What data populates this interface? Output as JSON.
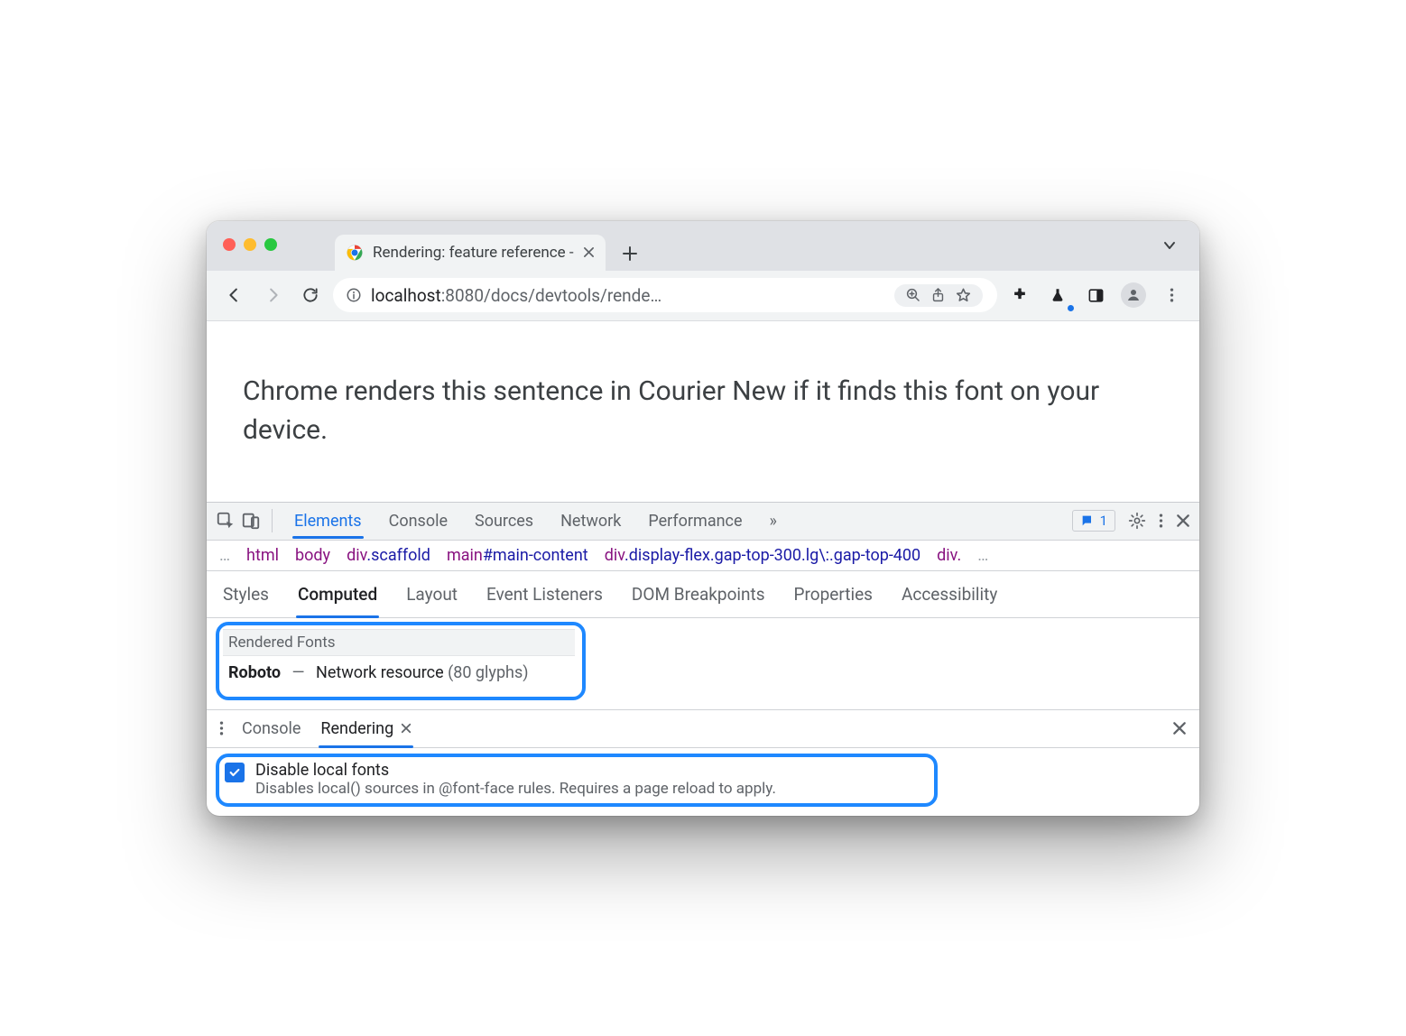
{
  "chrome": {
    "tab_title": "Rendering: feature reference -",
    "url_host": "localhost",
    "url_port": ":8080",
    "url_path": "/docs/devtools/rende…"
  },
  "page": {
    "text": "Chrome renders this sentence in Courier New if it finds this font on your device."
  },
  "devtools": {
    "tabs": {
      "elements": "Elements",
      "console": "Console",
      "sources": "Sources",
      "network": "Network",
      "performance": "Performance",
      "more": "»"
    },
    "issues_count": "1",
    "breadcrumb": {
      "ell_left": "…",
      "html": "html",
      "body": "body",
      "scaffold_tag": "div",
      "scaffold_cls": ".scaffold",
      "main_tag": "main",
      "main_id": "#main-content",
      "display_tag": "div",
      "display_cls": ".display-flex.gap-top-300.lg\\:.gap-top-400",
      "div_tail": "div.",
      "ell_right": "…"
    },
    "subtabs": {
      "styles": "Styles",
      "computed": "Computed",
      "layout": "Layout",
      "listeners": "Event Listeners",
      "dombp": "DOM Breakpoints",
      "properties": "Properties",
      "a11y": "Accessibility"
    },
    "rendered_fonts": {
      "title": "Rendered Fonts",
      "name": "Roboto",
      "source": "Network resource",
      "glyphs": "(80 glyphs)"
    },
    "drawer": {
      "console": "Console",
      "rendering": "Rendering"
    },
    "option": {
      "title": "Disable local fonts",
      "desc": "Disables local() sources in @font-face rules. Requires a page reload to apply."
    }
  }
}
